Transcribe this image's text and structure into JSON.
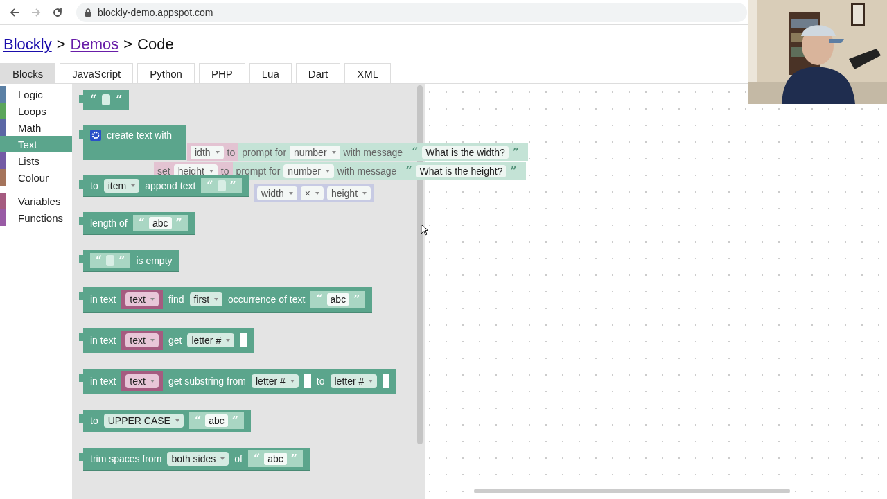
{
  "browser": {
    "nav": [
      {
        "kind": "back",
        "disabled": false
      },
      {
        "kind": "forward",
        "disabled": true
      },
      {
        "kind": "reload",
        "disabled": false
      }
    ],
    "url": "blockly-demo.appspot.com"
  },
  "breadcrumb": [
    {
      "kind": "link",
      "text": "Blockly"
    },
    {
      "kind": "sep",
      "text": ">"
    },
    {
      "kind": "visited",
      "text": "Demos"
    },
    {
      "kind": "sep",
      "text": ">"
    },
    {
      "kind": "current",
      "text": "Code"
    }
  ],
  "tabs": [
    {
      "label": "Blocks",
      "selected": true
    },
    {
      "label": "JavaScript",
      "selected": false
    },
    {
      "label": "Python",
      "selected": false
    },
    {
      "label": "PHP",
      "selected": false
    },
    {
      "label": "Lua",
      "selected": false
    },
    {
      "label": "Dart",
      "selected": false
    },
    {
      "label": "XML",
      "selected": false
    }
  ],
  "toolbox": {
    "groups": [
      [
        {
          "label": "Logic",
          "color": "#5b80a5",
          "selected": false
        },
        {
          "label": "Loops",
          "color": "#5ba55b",
          "selected": false
        },
        {
          "label": "Math",
          "color": "#5b67a5",
          "selected": false
        },
        {
          "label": "Text",
          "color": "#5ba58c",
          "selected": true
        },
        {
          "label": "Lists",
          "color": "#745ba5",
          "selected": false
        },
        {
          "label": "Colour",
          "color": "#a5745b",
          "selected": false
        }
      ],
      [
        {
          "label": "Variables",
          "color": "#a55b80",
          "selected": false
        },
        {
          "label": "Functions",
          "color": "#995ba5",
          "selected": false
        }
      ]
    ]
  },
  "flyout": {
    "blocks": [
      {
        "kind": "inline",
        "parts": [
          {
            "kind": "quote",
            "text": "“"
          },
          {
            "kind": "blank"
          },
          {
            "kind": "quote",
            "text": "”"
          }
        ]
      },
      {
        "kind": "tall",
        "parts": [
          {
            "kind": "gear"
          },
          {
            "kind": "label",
            "text": "create text with"
          }
        ]
      },
      {
        "kind": "inline",
        "parts": [
          {
            "kind": "label",
            "text": "to"
          },
          {
            "kind": "dropdown",
            "text": "item"
          },
          {
            "kind": "label",
            "text": "append text"
          },
          {
            "kind": "string",
            "open": "“",
            "close": "”"
          }
        ]
      },
      {
        "kind": "inline",
        "parts": [
          {
            "kind": "label",
            "text": "length of"
          },
          {
            "kind": "string",
            "open": "“",
            "value": "abc",
            "close": "”"
          }
        ]
      },
      {
        "kind": "inline",
        "parts": [
          {
            "kind": "string",
            "open": "“",
            "close": "”"
          },
          {
            "kind": "label",
            "text": "is empty"
          }
        ]
      },
      {
        "kind": "inline",
        "parts": [
          {
            "kind": "label",
            "text": "in text"
          },
          {
            "kind": "var",
            "text": "text"
          },
          {
            "kind": "label",
            "text": "find"
          },
          {
            "kind": "dropdown",
            "text": "first"
          },
          {
            "kind": "label",
            "text": "occurrence of text"
          },
          {
            "kind": "string",
            "open": "“",
            "value": "abc",
            "close": "”"
          }
        ]
      },
      {
        "kind": "inline",
        "parts": [
          {
            "kind": "label",
            "text": "in text"
          },
          {
            "kind": "var",
            "text": "text"
          },
          {
            "kind": "label",
            "text": "get"
          },
          {
            "kind": "dropdown",
            "text": "letter #"
          },
          {
            "kind": "slot"
          }
        ]
      },
      {
        "kind": "inline",
        "parts": [
          {
            "kind": "label",
            "text": "in text"
          },
          {
            "kind": "var",
            "text": "text"
          },
          {
            "kind": "label",
            "text": "get substring from"
          },
          {
            "kind": "dropdown",
            "text": "letter #"
          },
          {
            "kind": "slot"
          },
          {
            "kind": "label",
            "text": "to"
          },
          {
            "kind": "dropdown",
            "text": "letter #"
          },
          {
            "kind": "slot"
          }
        ]
      },
      {
        "kind": "inline",
        "parts": [
          {
            "kind": "label",
            "text": "to"
          },
          {
            "kind": "dropdown",
            "text": "UPPER CASE"
          },
          {
            "kind": "string",
            "open": "“",
            "value": "abc",
            "close": "”"
          }
        ]
      },
      {
        "kind": "inline",
        "parts": [
          {
            "kind": "label",
            "text": "trim spaces from"
          },
          {
            "kind": "dropdown",
            "text": "both sides"
          },
          {
            "kind": "label",
            "text": "of"
          },
          {
            "kind": "string",
            "open": "“",
            "value": "abc",
            "close": "”"
          }
        ]
      }
    ]
  },
  "workspace": {
    "blocks": [
      {
        "segments": [
          {
            "kind": "variable",
            "parts": [
              {
                "kind": "dropdown",
                "text": "idth"
              },
              {
                "kind": "label",
                "text": "to"
              }
            ]
          },
          {
            "kind": "text",
            "parts": [
              {
                "kind": "label",
                "text": "prompt for"
              },
              {
                "kind": "dropdown",
                "text": "number"
              },
              {
                "kind": "label",
                "text": "with message"
              },
              {
                "kind": "string",
                "open": "“",
                "value": "What is the width?",
                "close": "”"
              }
            ]
          }
        ]
      },
      {
        "segments": [
          {
            "kind": "variable",
            "parts": [
              {
                "kind": "label",
                "text": "set"
              },
              {
                "kind": "dropdown",
                "text": "height"
              },
              {
                "kind": "label",
                "text": "to"
              }
            ]
          },
          {
            "kind": "text",
            "parts": [
              {
                "kind": "label",
                "text": "prompt for"
              },
              {
                "kind": "dropdown",
                "text": "number"
              },
              {
                "kind": "label",
                "text": "with message"
              },
              {
                "kind": "string",
                "open": "“",
                "value": "What is the height?",
                "close": "”"
              }
            ]
          }
        ]
      },
      {
        "segments": [
          {
            "kind": "math",
            "parts": [
              {
                "kind": "dropdown",
                "text": "width"
              },
              {
                "kind": "dropdown",
                "text": "×"
              },
              {
                "kind": "dropdown",
                "text": "height"
              }
            ]
          }
        ]
      }
    ]
  }
}
